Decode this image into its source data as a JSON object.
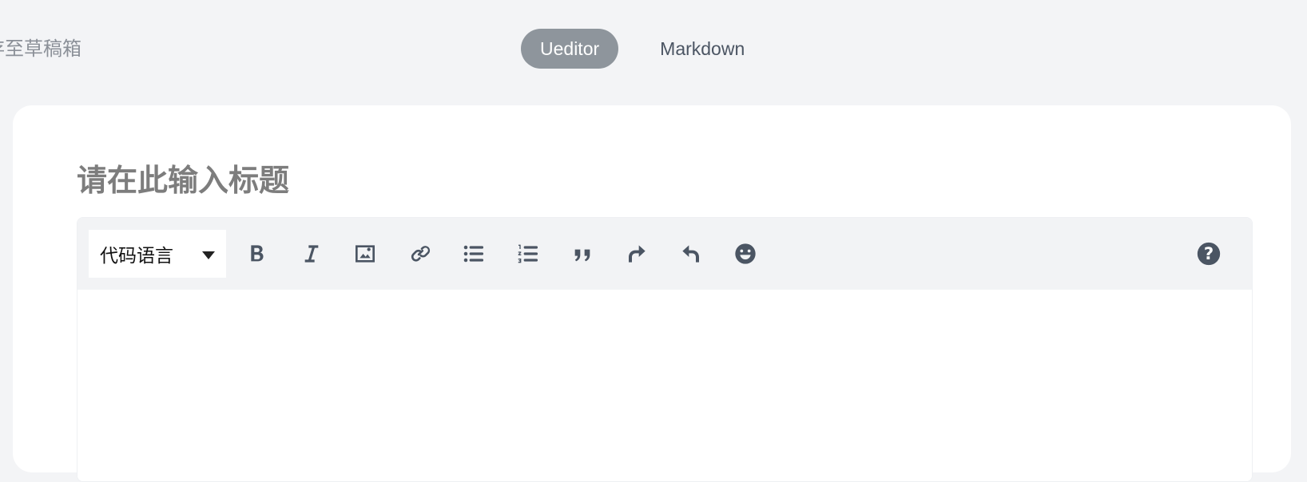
{
  "header": {
    "draft_link": "存至草稿箱",
    "modes": [
      {
        "label": "Ueditor",
        "active": true
      },
      {
        "label": "Markdown",
        "active": false
      }
    ]
  },
  "editor": {
    "title_placeholder": "请在此输入标题",
    "language_select": {
      "selected": "代码语言"
    },
    "toolbar_icons": [
      "bold-icon",
      "italic-icon",
      "image-icon",
      "link-icon",
      "unordered-list-icon",
      "ordered-list-icon",
      "quote-icon",
      "redo-icon",
      "undo-icon",
      "emoji-icon",
      "help-icon"
    ]
  },
  "colors": {
    "background": "#f3f4f6",
    "active_tab": "#8e959c",
    "toolbar": "#f2f3f5",
    "icon": "#4b5563"
  }
}
